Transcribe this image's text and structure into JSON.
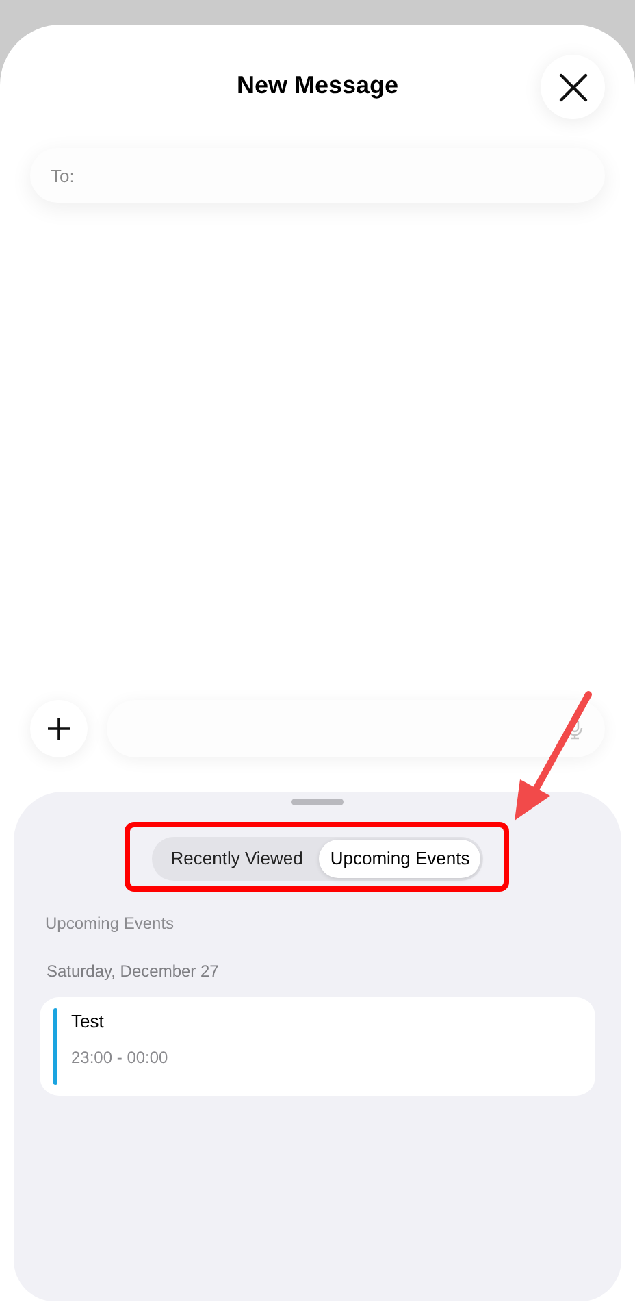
{
  "header": {
    "title": "New Message"
  },
  "recipient_field": {
    "placeholder": "To:"
  },
  "segments": [
    {
      "label": "Recently Viewed",
      "selected": false
    },
    {
      "label": "Upcoming Events",
      "selected": true
    }
  ],
  "section_title": "Upcoming Events",
  "date_heading": "Saturday, December 27",
  "events": [
    {
      "title": "Test",
      "time": "23:00 - 00:00",
      "color": "#1ba4e0"
    }
  ]
}
